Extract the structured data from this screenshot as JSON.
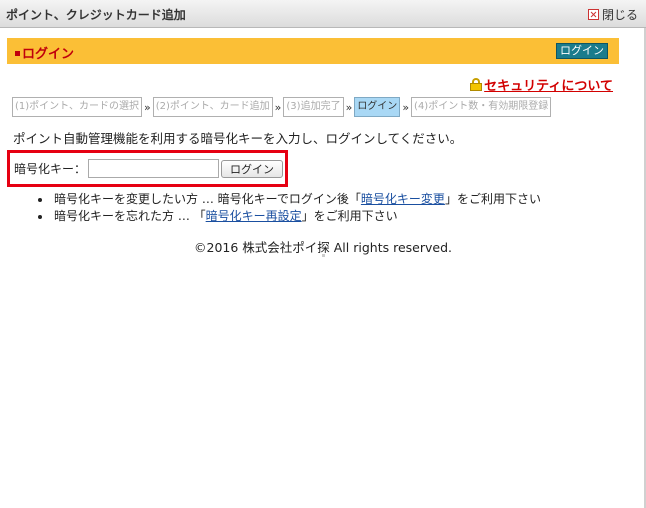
{
  "window": {
    "title": "ポイント、クレジットカード追加",
    "close_label": "閉じる"
  },
  "header": {
    "title": "ログイン",
    "button_label": "ログイン"
  },
  "security_link": "セキュリティについて",
  "steps": [
    {
      "label": "(1)ポイント、カードの選択",
      "active": false
    },
    {
      "label": "(2)ポイント、カード追加",
      "active": false
    },
    {
      "label": "(3)追加完了",
      "active": false
    },
    {
      "label": "ログイン",
      "active": true
    },
    {
      "label": "(4)ポイント数・有効期限登録",
      "active": false
    }
  ],
  "step_arrow": "»",
  "instruction": "ポイント自動管理機能を利用する暗号化キーを入力し、ログインしてください。",
  "login_form": {
    "label": "暗号化キー：",
    "input_value": "",
    "button_label": "ログイン"
  },
  "notes": [
    {
      "prefix": "暗号化キーを変更したい方 … 暗号化キーでログイン後「",
      "link": "暗号化キー変更",
      "suffix": "」をご利用下さい"
    },
    {
      "prefix": "暗号化キーを忘れた方 … 「",
      "link": "暗号化キー再設定",
      "suffix": "」をご利用下さい"
    }
  ],
  "copyright": "©2016 株式会社ポイ探 All rights reserved.",
  "colors": {
    "header_bg": "#fbbf36",
    "header_text": "#c0000c",
    "highlight_border": "#e60012",
    "active_step": "#a9d8f5",
    "link": "#1a4fa0"
  }
}
